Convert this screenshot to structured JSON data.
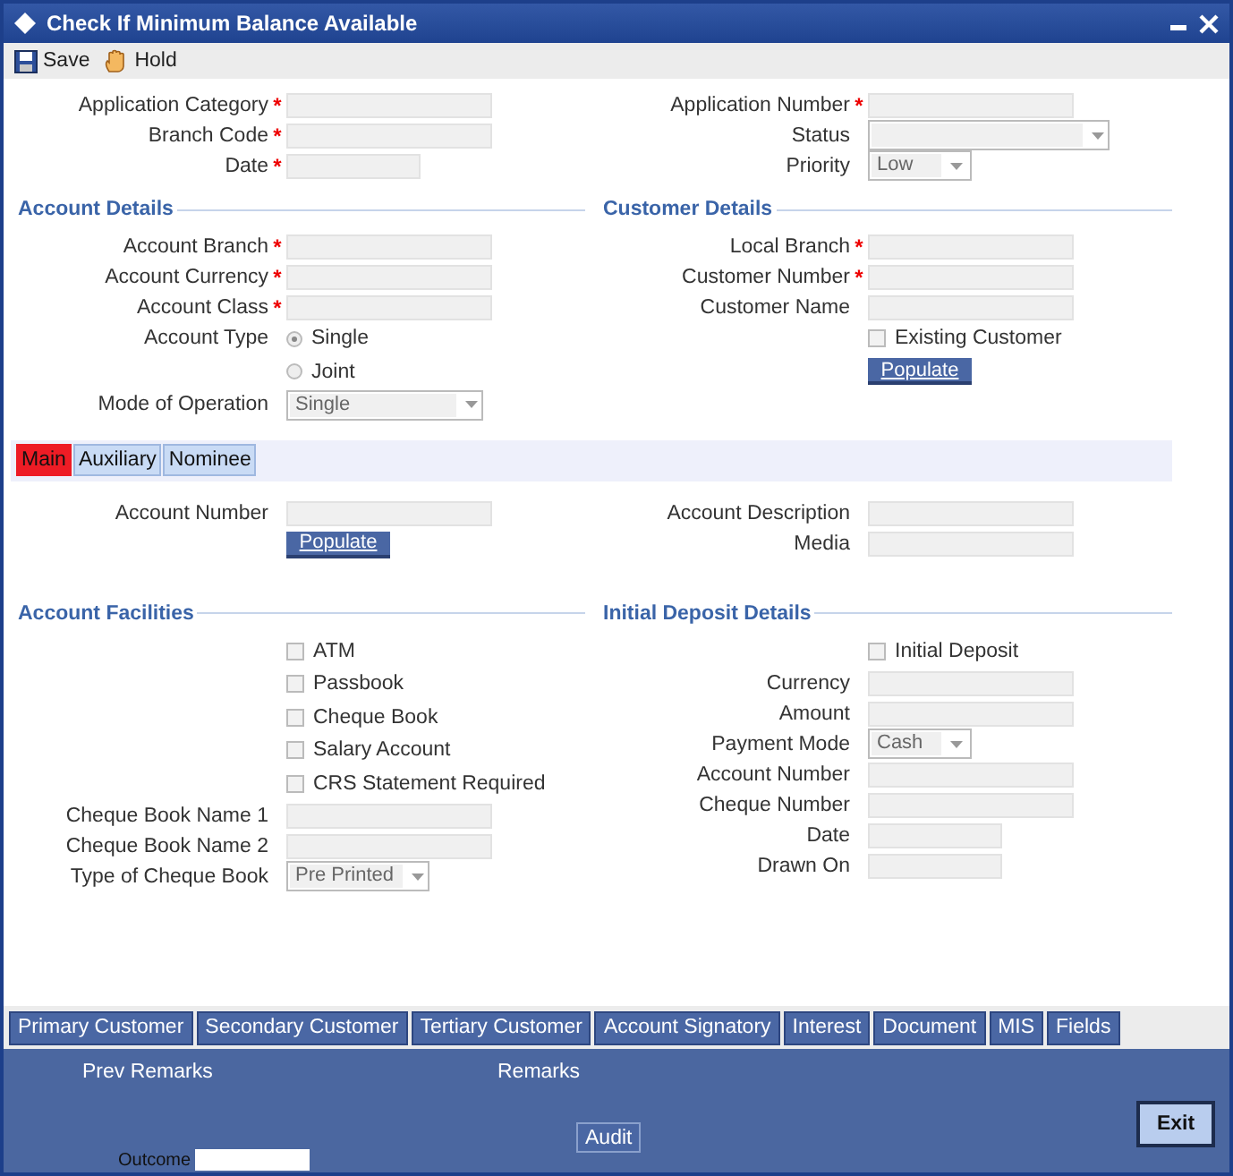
{
  "window": {
    "title": "Check If Minimum Balance Available"
  },
  "toolbar": [
    {
      "label": "Save"
    },
    {
      "label": "Hold"
    }
  ],
  "header": {
    "left": [
      {
        "kind": "text",
        "label": "Application Category",
        "required_mark": "*"
      },
      {
        "kind": "text",
        "label": "Branch Code",
        "required_mark": "*"
      },
      {
        "kind": "short_text",
        "label": "Date",
        "required_mark": "*"
      }
    ],
    "right": [
      {
        "kind": "text",
        "label": "Application Number",
        "required_mark": "*"
      },
      {
        "kind": "select",
        "label": "Status"
      },
      {
        "kind": "small_select",
        "label": "Priority",
        "value": "Low"
      }
    ]
  },
  "account_details": {
    "title": "Account Details",
    "rows": [
      {
        "kind": "text",
        "label": "Account Branch",
        "required_mark": "*"
      },
      {
        "kind": "text",
        "label": "Account Currency",
        "required_mark": "*"
      },
      {
        "kind": "text",
        "label": "Account Class",
        "required_mark": "*"
      },
      {
        "kind": "radio",
        "label": "Account Type",
        "option": "Single",
        "selected": true
      },
      {
        "kind": "radio",
        "option": "Joint",
        "selected": false
      },
      {
        "kind": "select",
        "label": "Mode of Operation",
        "value": "Single"
      }
    ]
  },
  "customer_details": {
    "title": "Customer Details",
    "rows": [
      {
        "kind": "text",
        "label": "Local Branch",
        "required_mark": "*"
      },
      {
        "kind": "text",
        "label": "Customer Number",
        "required_mark": "*"
      },
      {
        "kind": "text",
        "label": "Customer Name"
      },
      {
        "kind": "checkbox",
        "option": "Existing Customer",
        "checked": false
      },
      {
        "kind": "button",
        "text": "Populate"
      }
    ]
  },
  "tabs": [
    {
      "label": "Main",
      "selected": true
    },
    {
      "label": "Auxiliary",
      "selected": false
    },
    {
      "label": "Nominee",
      "selected": false
    }
  ],
  "main_tab": {
    "left": [
      {
        "kind": "text",
        "label": "Account Number"
      },
      {
        "kind": "button",
        "text": "Populate"
      }
    ],
    "right": [
      {
        "kind": "text",
        "label": "Account Description"
      },
      {
        "kind": "text",
        "label": "Media"
      }
    ]
  },
  "account_facilities": {
    "title": "Account Facilities",
    "rows": [
      {
        "kind": "checkbox",
        "option": "ATM",
        "checked": false
      },
      {
        "kind": "checkbox",
        "option": "Passbook",
        "checked": false
      },
      {
        "kind": "checkbox",
        "option": "Cheque Book",
        "checked": false
      },
      {
        "kind": "checkbox",
        "option": "Salary Account",
        "checked": false
      },
      {
        "kind": "checkbox",
        "option": "CRS Statement Required",
        "checked": false
      },
      {
        "kind": "text",
        "label": "Cheque Book Name 1"
      },
      {
        "kind": "text",
        "label": "Cheque Book Name 2"
      },
      {
        "kind": "small_select",
        "label": "Type of Cheque Book",
        "value": "Pre Printed"
      }
    ]
  },
  "initial_deposit": {
    "title": "Initial Deposit Details",
    "rows": [
      {
        "kind": "checkbox",
        "option": "Initial Deposit",
        "checked": false
      },
      {
        "kind": "text",
        "label": "Currency"
      },
      {
        "kind": "text",
        "label": "Amount"
      },
      {
        "kind": "small_select",
        "label": "Payment Mode",
        "value": "Cash"
      },
      {
        "kind": "text",
        "label": "Account Number"
      },
      {
        "kind": "text",
        "label": "Cheque Number"
      },
      {
        "kind": "short_text",
        "label": "Date"
      },
      {
        "kind": "short_text",
        "label": "Drawn On"
      }
    ]
  },
  "bottom_tabs": [
    "Primary Customer",
    "Secondary Customer",
    "Tertiary Customer",
    "Account Signatory",
    "Interest",
    "Document",
    "MIS",
    "Fields"
  ],
  "footer": {
    "prev_remarks": "Prev Remarks",
    "remarks": "Remarks",
    "audit_button": "Audit",
    "exit_button": "Exit",
    "outcome_label": "Outcome"
  }
}
